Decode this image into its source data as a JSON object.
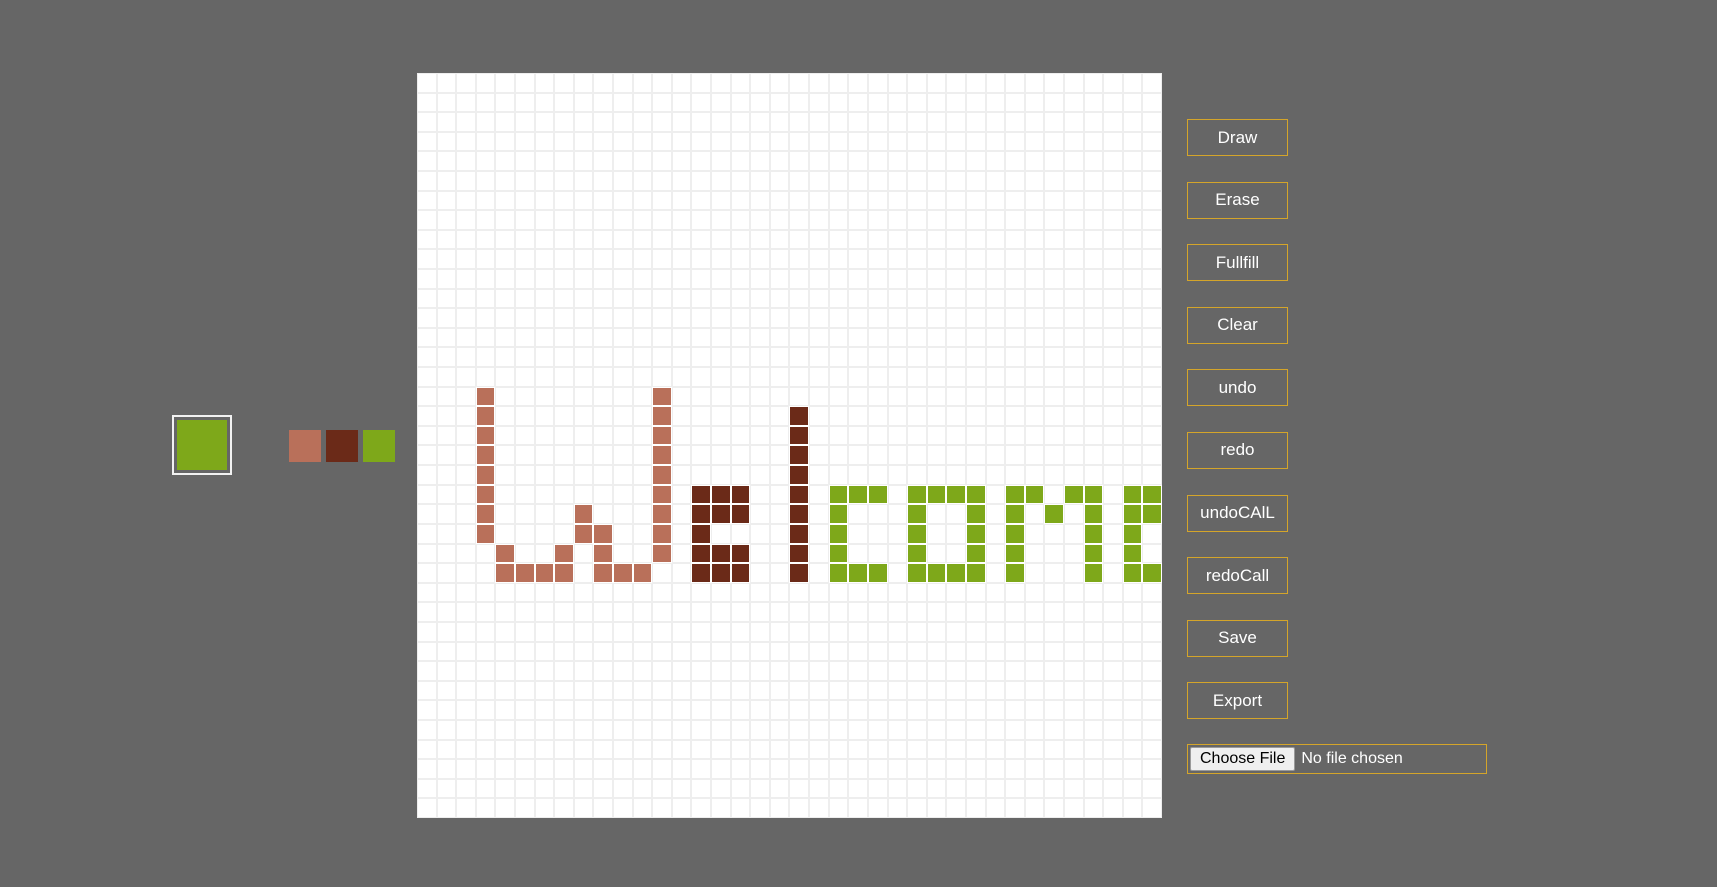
{
  "current_color": "#7ea81a",
  "palette": [
    {
      "name": "terracotta",
      "color": "#b9705a"
    },
    {
      "name": "dark-brown",
      "color": "#6b2a18"
    },
    {
      "name": "olive-green",
      "color": "#7ea81a"
    }
  ],
  "grid": {
    "rows": 38,
    "cols": 38,
    "paint": [
      {
        "color": "#b9705a",
        "cells": [
          [
            16,
            3
          ],
          [
            17,
            3
          ],
          [
            18,
            3
          ],
          [
            19,
            3
          ],
          [
            20,
            3
          ],
          [
            21,
            3
          ],
          [
            22,
            3
          ],
          [
            23,
            3
          ],
          [
            24,
            4
          ],
          [
            25,
            4
          ],
          [
            25,
            5
          ],
          [
            25,
            6
          ],
          [
            24,
            7
          ],
          [
            25,
            7
          ],
          [
            22,
            8
          ],
          [
            23,
            8
          ],
          [
            24,
            9
          ],
          [
            25,
            9
          ],
          [
            23,
            9
          ],
          [
            25,
            10
          ],
          [
            25,
            11
          ],
          [
            24,
            12
          ],
          [
            16,
            12
          ],
          [
            17,
            12
          ],
          [
            18,
            12
          ],
          [
            19,
            12
          ],
          [
            20,
            12
          ],
          [
            21,
            12
          ],
          [
            22,
            12
          ],
          [
            23,
            12
          ]
        ]
      },
      {
        "color": "#6b2a18",
        "cells": [
          [
            21,
            14
          ],
          [
            21,
            15
          ],
          [
            21,
            16
          ],
          [
            22,
            14
          ],
          [
            22,
            15
          ],
          [
            22,
            16
          ],
          [
            23,
            14
          ],
          [
            24,
            14
          ],
          [
            24,
            15
          ],
          [
            24,
            16
          ],
          [
            25,
            14
          ],
          [
            25,
            15
          ],
          [
            25,
            16
          ],
          [
            17,
            19
          ],
          [
            18,
            19
          ],
          [
            19,
            19
          ],
          [
            20,
            19
          ],
          [
            21,
            19
          ],
          [
            22,
            19
          ],
          [
            23,
            19
          ],
          [
            24,
            19
          ],
          [
            25,
            19
          ]
        ]
      },
      {
        "color": "#7ea81a",
        "cells": [
          [
            21,
            21
          ],
          [
            21,
            22
          ],
          [
            21,
            23
          ],
          [
            22,
            21
          ],
          [
            23,
            21
          ],
          [
            24,
            21
          ],
          [
            25,
            21
          ],
          [
            25,
            22
          ],
          [
            25,
            23
          ],
          [
            21,
            25
          ],
          [
            21,
            26
          ],
          [
            21,
            27
          ],
          [
            21,
            28
          ],
          [
            22,
            25
          ],
          [
            22,
            28
          ],
          [
            23,
            25
          ],
          [
            23,
            28
          ],
          [
            24,
            25
          ],
          [
            24,
            28
          ],
          [
            25,
            25
          ],
          [
            25,
            26
          ],
          [
            25,
            27
          ],
          [
            25,
            28
          ],
          [
            21,
            30
          ],
          [
            21,
            31
          ],
          [
            21,
            33
          ],
          [
            21,
            34
          ],
          [
            22,
            30
          ],
          [
            22,
            32
          ],
          [
            22,
            34
          ],
          [
            23,
            30
          ],
          [
            23,
            34
          ],
          [
            24,
            30
          ],
          [
            24,
            34
          ],
          [
            25,
            30
          ],
          [
            25,
            34
          ],
          [
            21,
            36
          ],
          [
            21,
            37
          ],
          [
            22,
            36
          ],
          [
            22,
            37
          ],
          [
            23,
            36
          ],
          [
            24,
            36
          ],
          [
            25,
            36
          ],
          [
            25,
            37
          ]
        ]
      }
    ]
  },
  "tools": [
    {
      "key": "draw",
      "label": "Draw"
    },
    {
      "key": "erase",
      "label": "Erase"
    },
    {
      "key": "fullfill",
      "label": "Fullfill"
    },
    {
      "key": "clear",
      "label": "Clear"
    },
    {
      "key": "undo",
      "label": "undo"
    },
    {
      "key": "redo",
      "label": "redo"
    },
    {
      "key": "undocall",
      "label": "undoCAlL"
    },
    {
      "key": "redocall",
      "label": "redoCall"
    },
    {
      "key": "save",
      "label": "Save"
    },
    {
      "key": "export",
      "label": "Export"
    }
  ],
  "file_input": {
    "button_label": "Choose File",
    "status": "No file chosen"
  }
}
